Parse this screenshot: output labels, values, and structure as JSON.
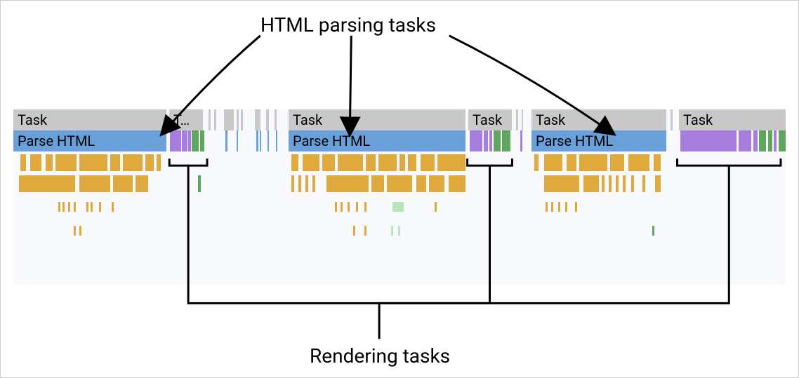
{
  "labels": {
    "top": "HTML parsing tasks",
    "bottom": "Rendering tasks"
  },
  "tasks": {
    "task": "Task",
    "task_truncated": "T…",
    "parse_html": "Parse HTML"
  },
  "colors": {
    "gray": "#c8c8c8",
    "blue": "#6aa0d9",
    "purple": "#a87de0",
    "green": "#5fa65f",
    "gold": "#e0a93e",
    "bg": "#f7f9fc"
  }
}
